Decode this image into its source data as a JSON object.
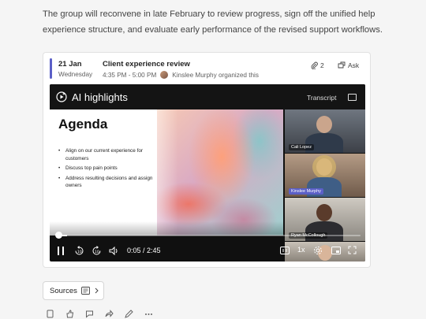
{
  "intro_text": "The group will reconvene in late February to review progress, sign off the unified help experience structure, and evaluate early performance of the revised support workflows.",
  "event": {
    "date": "21 Jan",
    "weekday": "Wednesday",
    "title": "Client experience review",
    "time": "4:35 PM - 5:00 PM",
    "organizer_text": "Kinslee Murphy organized this",
    "attachments_count": "2",
    "ask_label": "Ask"
  },
  "video": {
    "header_title": "AI highlights",
    "transcript_label": "Transcript",
    "slide_title": "Agenda",
    "slide_items": [
      "Align on our current experience for customers",
      "Discuss top pain points",
      "Address resulting decisions and assign owners"
    ],
    "participants": [
      "Cali Lopez",
      "Kinslee Murphy",
      "Ryan McCollough",
      ""
    ],
    "time_display": "0:05 / 2:45",
    "speed_label": "1x",
    "progress_fraction": 0.03
  },
  "sources_label": "Sources",
  "colors": {
    "accent": "#5b5fc7",
    "video_bg": "#101010"
  }
}
